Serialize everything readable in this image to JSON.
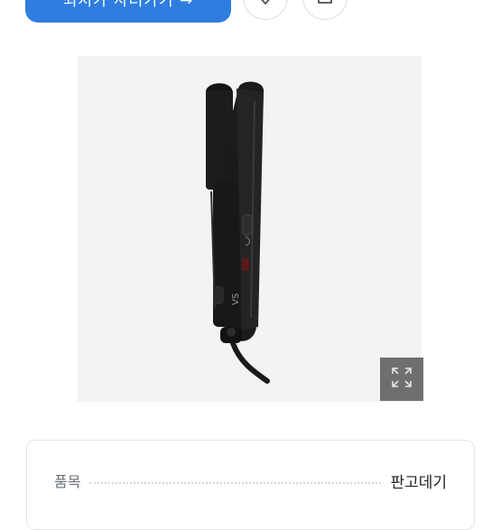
{
  "actions": {
    "primary_label": "최저가 사러가기 →",
    "wishlist_icon": "heart-icon",
    "share_icon": "share-icon"
  },
  "gallery": {
    "image_alt": "VS hair straightener",
    "expand_icon": "expand-icon"
  },
  "details": {
    "rows": [
      {
        "label": "품목",
        "value": "판고데기"
      }
    ]
  },
  "colors": {
    "accent": "#2f7de1",
    "image_bg": "#f3f3f4",
    "expand_bg": "#6f6f6f"
  }
}
